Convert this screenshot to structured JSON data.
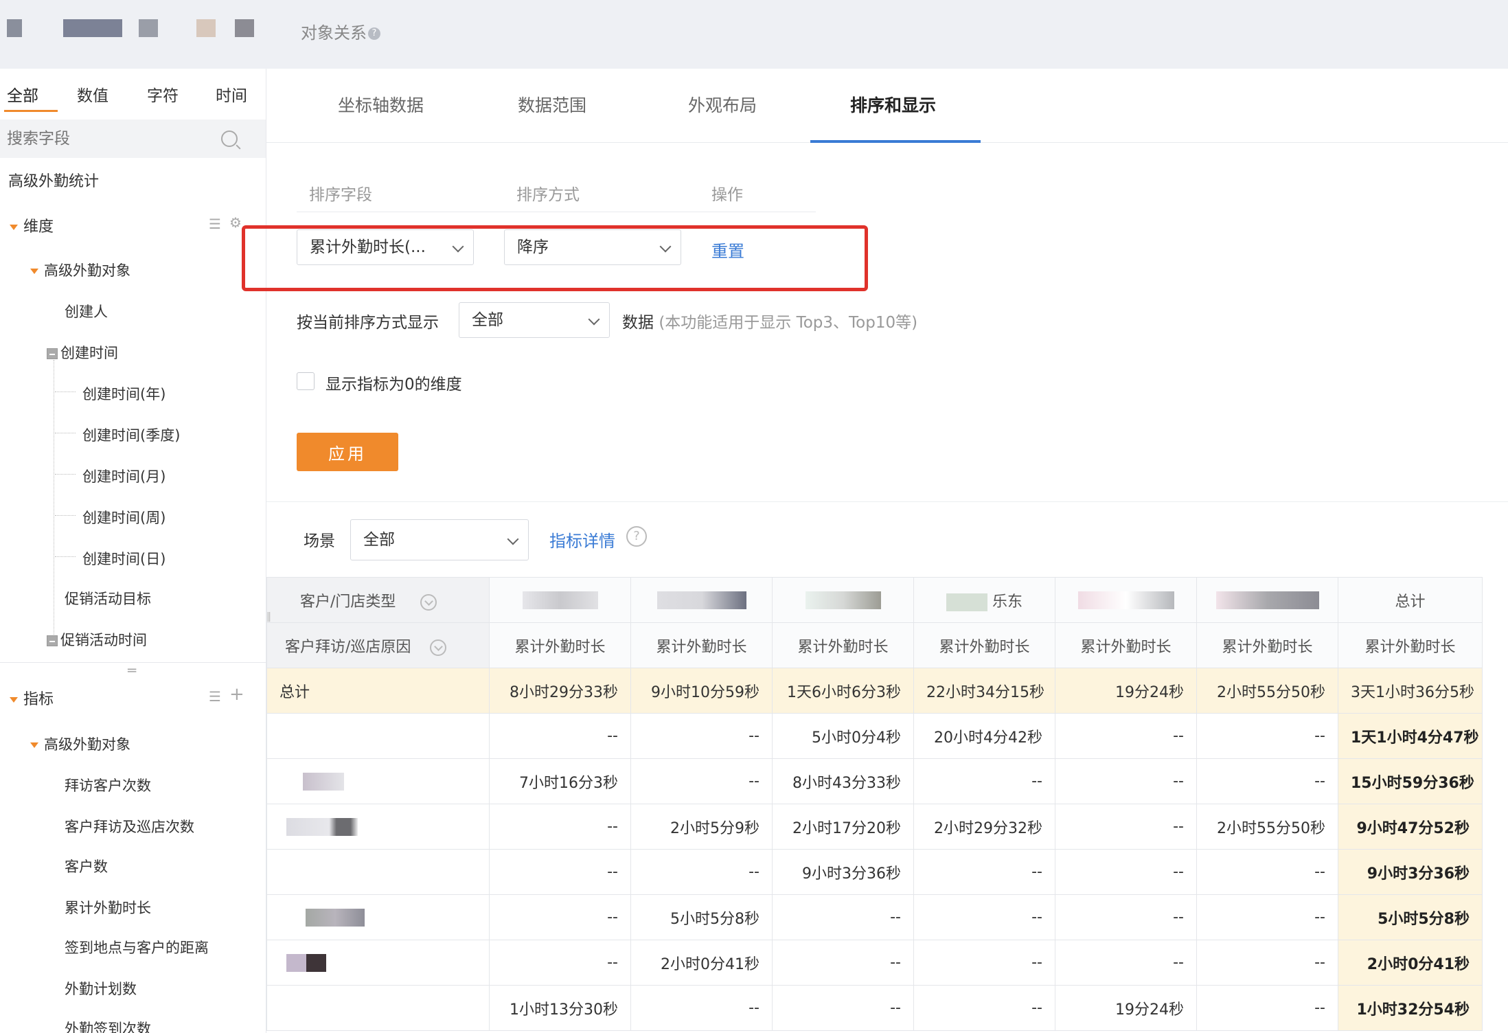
{
  "topbar": {
    "title": "对象关系",
    "help": "?"
  },
  "sidebar": {
    "tabs": [
      "全部",
      "数值",
      "字符",
      "时间"
    ],
    "search_placeholder": "搜索字段",
    "group_title": "高级外勤统计",
    "dimension_label": "维度",
    "dimension_object": "高级外勤对象",
    "dimension_items": [
      "创建人",
      "创建时间",
      "创建时间(年)",
      "创建时间(季度)",
      "创建时间(月)",
      "创建时间(周)",
      "创建时间(日)",
      "促销活动目标",
      "促销活动时间"
    ],
    "metric_label": "指标",
    "metric_object": "高级外勤对象",
    "metric_items": [
      "拜访客户次数",
      "客户拜访及巡店次数",
      "客户数",
      "累计外勤时长",
      "签到地点与客户的距离",
      "外勤计划数",
      "外勤签到次数"
    ]
  },
  "main_tabs": [
    "坐标轴数据",
    "数据范围",
    "外观布局",
    "排序和显示"
  ],
  "sort": {
    "headers": [
      "排序字段",
      "排序方式",
      "操作"
    ],
    "field_value": "累计外勤时长(...",
    "order_value": "降序",
    "reset_label": "重置"
  },
  "display": {
    "label": "按当前排序方式显示",
    "value": "全部",
    "suffix": "数据",
    "hint": "(本功能适用于显示 Top3、Top10等)"
  },
  "show_zero_label": "显示指标为0的维度",
  "apply_label": "应用",
  "scene": {
    "label": "场景",
    "value": "全部",
    "detail_link": "指标详情",
    "help": "?"
  },
  "table": {
    "row_header_1": "客户/门店类型",
    "row_header_2": "客户拜访/巡店原因",
    "partial_col_text": "乐东",
    "total_col_header": "总计",
    "metric_header": "累计外勤时长",
    "total_row_label": "总计",
    "rows": [
      [
        "8小时29分33秒",
        "9小时10分59秒",
        "1天6小时6分3秒",
        "22小时34分15秒",
        "19分24秒",
        "2小时55分50秒",
        "3天1小时36分5秒"
      ],
      [
        "--",
        "--",
        "5小时0分4秒",
        "20小时4分42秒",
        "--",
        "--",
        "1天1小时4分47秒"
      ],
      [
        "7小时16分3秒",
        "--",
        "8小时43分33秒",
        "--",
        "--",
        "--",
        "15小时59分36秒"
      ],
      [
        "--",
        "2小时5分9秒",
        "2小时17分20秒",
        "2小时29分32秒",
        "--",
        "2小时55分50秒",
        "9小时47分52秒"
      ],
      [
        "--",
        "--",
        "9小时3分36秒",
        "--",
        "--",
        "--",
        "9小时3分36秒"
      ],
      [
        "--",
        "5小时5分8秒",
        "--",
        "--",
        "--",
        "--",
        "5小时5分8秒"
      ],
      [
        "--",
        "2小时0分41秒",
        "--",
        "--",
        "--",
        "--",
        "2小时0分41秒"
      ],
      [
        "1小时13分30秒",
        "--",
        "--",
        "--",
        "19分24秒",
        "--",
        "1小时32分54秒"
      ]
    ]
  },
  "colors": {
    "accent": "#f08a2c",
    "link": "#3a7bd5",
    "highlight": "#e0322b",
    "total_bg": "#fdf4dd"
  }
}
